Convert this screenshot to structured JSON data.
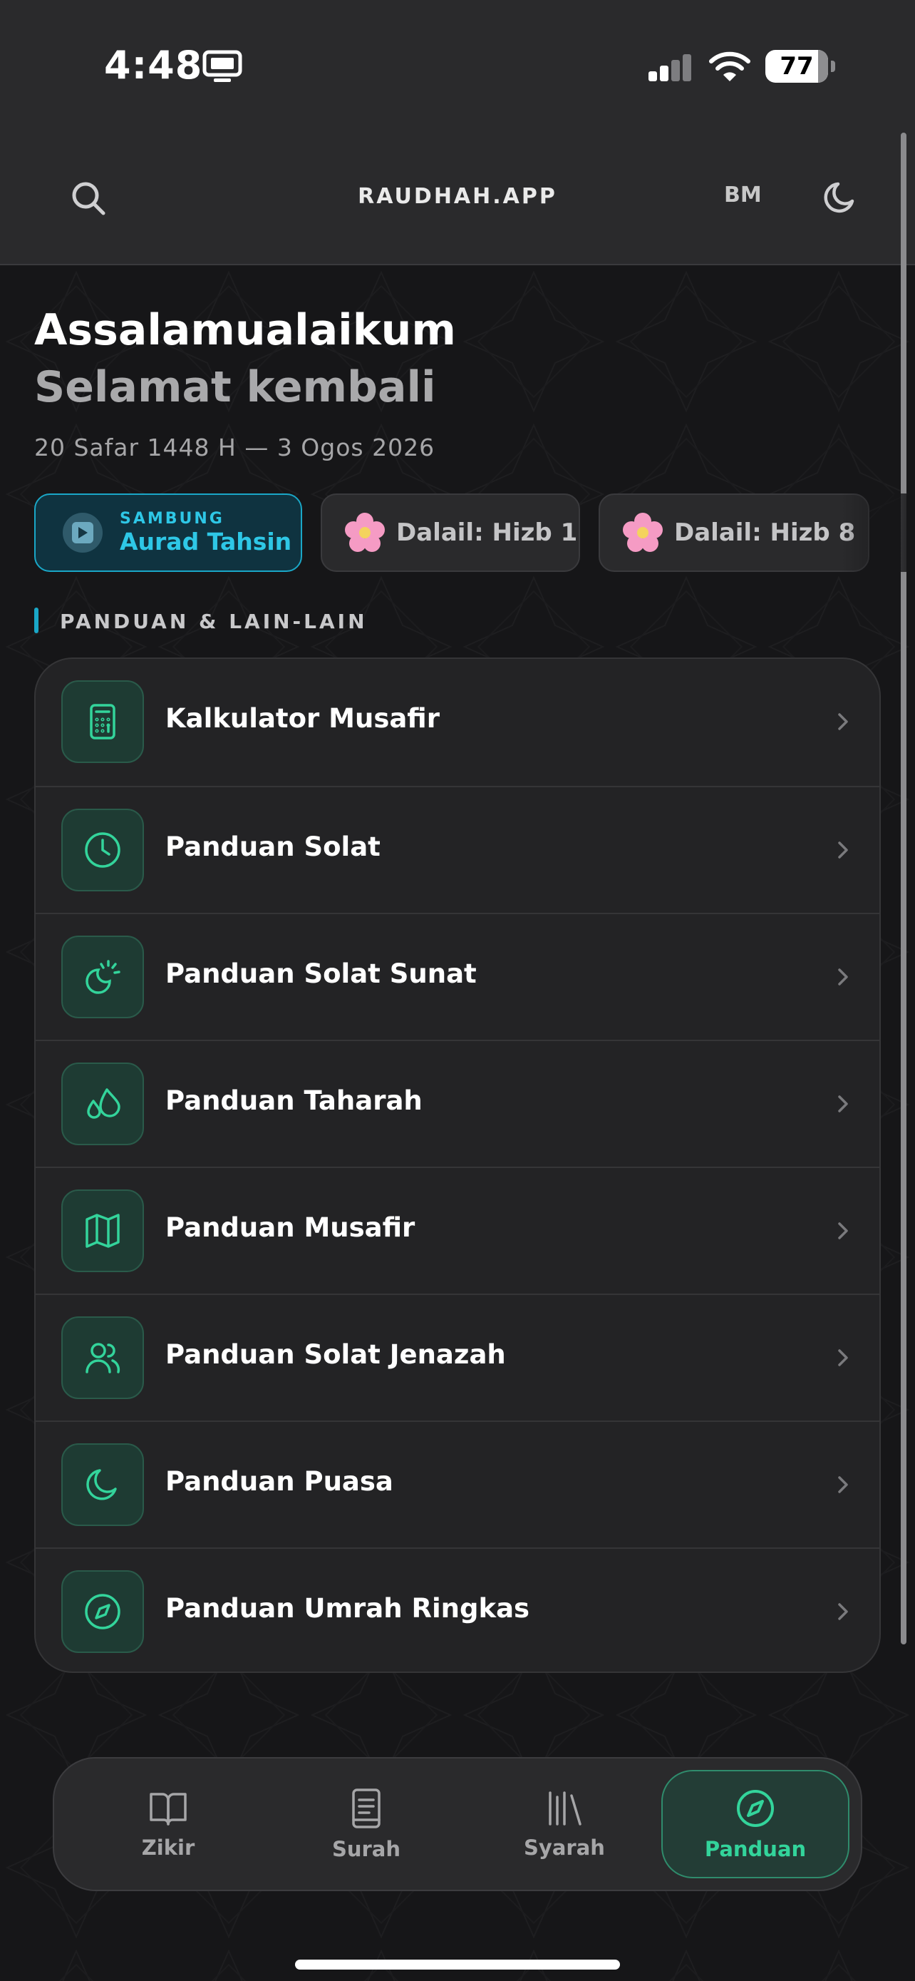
{
  "status_bar": {
    "time": "4:48",
    "battery": "77"
  },
  "header": {
    "title": "RAUDHAH.APP",
    "lang": "BM"
  },
  "greeting": {
    "line1": "Assalamualaikum",
    "line2": "Selamat kembali",
    "date": "20 Safar 1448 H — 3 Ogos 2026"
  },
  "chips": {
    "continue_small": "SAMBUNG",
    "continue_big": "Aurad Tahsin",
    "dalail1": "Dalail: Hizb 1",
    "dalail2": "Dalail: Hizb 8"
  },
  "section": {
    "label": "PANDUAN & LAIN-LAIN"
  },
  "list": [
    {
      "label": "Kalkulator Musafir",
      "icon": "calculator-icon"
    },
    {
      "label": "Panduan Solat",
      "icon": "clock-icon"
    },
    {
      "label": "Panduan Solat Sunat",
      "icon": "moon-sun-icon"
    },
    {
      "label": "Panduan Taharah",
      "icon": "droplets-icon"
    },
    {
      "label": "Panduan Musafir",
      "icon": "map-icon"
    },
    {
      "label": "Panduan Solat Jenazah",
      "icon": "users-icon"
    },
    {
      "label": "Panduan Puasa",
      "icon": "moon-icon"
    },
    {
      "label": "Panduan Umrah Ringkas",
      "icon": "compass-icon"
    }
  ],
  "nav": [
    {
      "label": "Zikir",
      "icon": "book-open-icon"
    },
    {
      "label": "Surah",
      "icon": "book-icon"
    },
    {
      "label": "Syarah",
      "icon": "library-icon"
    },
    {
      "label": "Panduan",
      "icon": "compass-icon",
      "active": true
    }
  ],
  "colors": {
    "accent_green": "#33d49b",
    "accent_cyan": "#2ec7e6",
    "background": "#161618"
  }
}
